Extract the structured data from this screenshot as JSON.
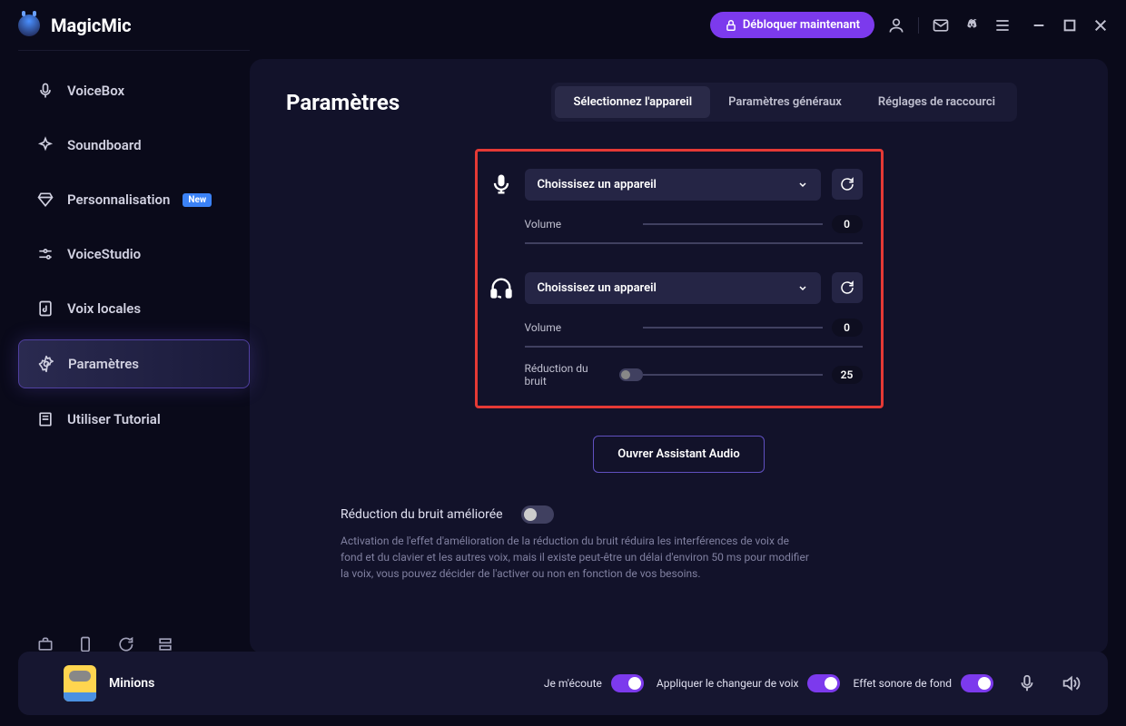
{
  "app": {
    "name": "MagicMic"
  },
  "titlebar": {
    "unlock_label": "Débloquer maintenant"
  },
  "sidebar": {
    "items": [
      {
        "label": "VoiceBox"
      },
      {
        "label": "Soundboard"
      },
      {
        "label": "Personnalisation",
        "badge": "New"
      },
      {
        "label": "VoiceStudio"
      },
      {
        "label": "Voix locales"
      },
      {
        "label": "Paramètres"
      },
      {
        "label": "Utiliser Tutorial"
      }
    ]
  },
  "content": {
    "title": "Paramètres",
    "tabs": [
      {
        "label": "Sélectionnez l'appareil"
      },
      {
        "label": "Paramètres généraux"
      },
      {
        "label": "Réglages de raccourci"
      }
    ],
    "mic": {
      "select_label": "Choissisez un appareil",
      "volume_label": "Volume",
      "volume_value": "0"
    },
    "head": {
      "select_label": "Choissisez un appareil",
      "volume_label": "Volume",
      "volume_value": "0",
      "noise_label": "Réduction du bruit",
      "noise_value": "25"
    },
    "assistant_btn": "Ouvrer Assistant Audio",
    "enhanced": {
      "title": "Réduction du bruit améliorée",
      "desc": "Activation de l'effet d'amélioration de la réduction du bruit réduira les interférences de voix de fond et du clavier et les autres voix, mais il existe peut-être un délai d'environ 50 ms pour modifier la voix, vous pouvez décider de l'activer ou non en fonction de vos besoins."
    }
  },
  "footer": {
    "voice_name": "Minions",
    "listen_label": "Je m'écoute",
    "apply_label": "Appliquer le changeur de voix",
    "bg_label": "Effet sonore de fond"
  }
}
